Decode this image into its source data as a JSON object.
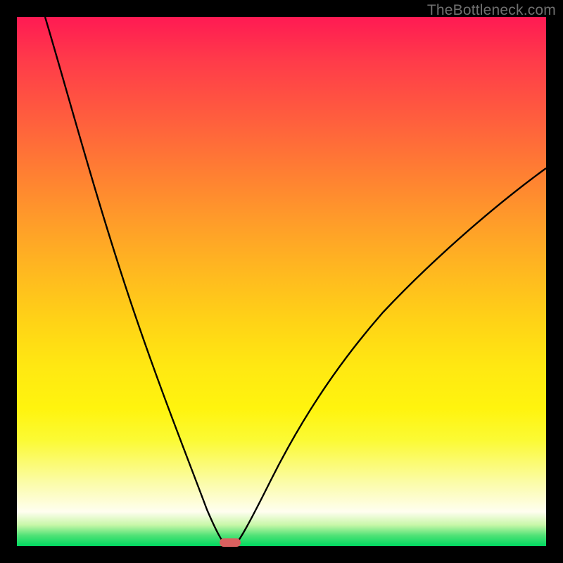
{
  "watermark": "TheBottleneck.com",
  "colors": {
    "frame": "#000000",
    "curve": "#000000",
    "marker": "#d9605f"
  },
  "chart_data": {
    "type": "line",
    "title": "",
    "xlabel": "",
    "ylabel": "",
    "xlim": [
      0,
      1
    ],
    "ylim": [
      0,
      1
    ],
    "is_normalized": true,
    "note": "V-shaped bottleneck curve on rainbow heat gradient background. No axis tick labels are present in the source image; x/y values are fractional plot-area coordinates (origin top-left).",
    "series": [
      {
        "name": "left-branch",
        "x": [
          0.053,
          0.08,
          0.11,
          0.14,
          0.18,
          0.22,
          0.26,
          0.3,
          0.33,
          0.355,
          0.37,
          0.38,
          0.388
        ],
        "y": [
          0.0,
          0.11,
          0.225,
          0.335,
          0.47,
          0.59,
          0.7,
          0.8,
          0.875,
          0.93,
          0.965,
          0.985,
          0.995
        ]
      },
      {
        "name": "right-branch",
        "x": [
          0.418,
          0.43,
          0.45,
          0.48,
          0.52,
          0.57,
          0.63,
          0.7,
          0.78,
          0.87,
          0.96,
          1.0
        ],
        "y": [
          0.995,
          0.98,
          0.95,
          0.9,
          0.83,
          0.745,
          0.65,
          0.555,
          0.46,
          0.37,
          0.295,
          0.265
        ]
      }
    ],
    "marker": {
      "x_fraction": 0.403,
      "y_fraction": 0.994
    },
    "gradient_stops": [
      {
        "pos": 0.0,
        "color": "#ff1a53"
      },
      {
        "pos": 0.5,
        "color": "#ffd416"
      },
      {
        "pos": 0.8,
        "color": "#fbfa34"
      },
      {
        "pos": 0.94,
        "color": "#fffef0"
      },
      {
        "pos": 1.0,
        "color": "#00d860"
      }
    ]
  }
}
